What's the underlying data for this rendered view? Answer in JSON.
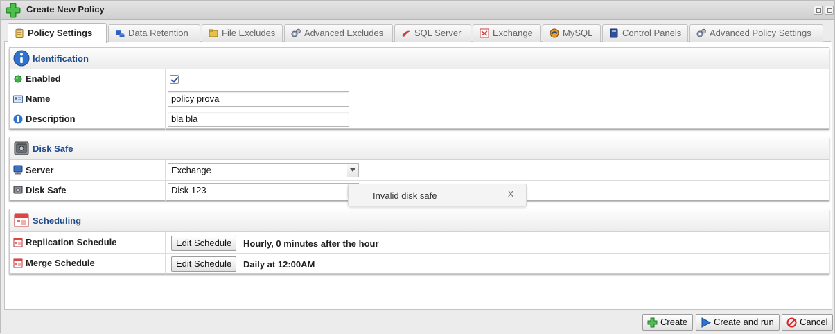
{
  "window": {
    "title": "Create New Policy",
    "window_buttons": [
      "restore-icon",
      "maximize-icon"
    ]
  },
  "tabs": [
    {
      "label": "Policy Settings",
      "icon": "clipboard-icon",
      "active": true
    },
    {
      "label": "Data Retention",
      "icon": "database-icon",
      "active": false
    },
    {
      "label": "File Excludes",
      "icon": "folder-icon",
      "active": false
    },
    {
      "label": "Advanced Excludes",
      "icon": "gears-icon",
      "active": false
    },
    {
      "label": "SQL Server",
      "icon": "sql-server-icon",
      "active": false
    },
    {
      "label": "Exchange",
      "icon": "exchange-icon",
      "active": false
    },
    {
      "label": "MySQL",
      "icon": "mysql-icon",
      "active": false
    },
    {
      "label": "Control Panels",
      "icon": "book-icon",
      "active": false
    },
    {
      "label": "Advanced Policy Settings",
      "icon": "gears-icon",
      "active": false
    }
  ],
  "identification": {
    "title": "Identification",
    "enabled_label": "Enabled",
    "enabled_checked": true,
    "name_label": "Name",
    "name_value": "policy prova",
    "description_label": "Description",
    "description_value": "bla bla"
  },
  "disk_safe": {
    "title": "Disk Safe",
    "server_label": "Server",
    "server_value": "Exchange",
    "disk_safe_label": "Disk Safe",
    "disk_safe_value": "Disk 123",
    "tooltip_text": "Invalid disk safe",
    "tooltip_close": "X"
  },
  "scheduling": {
    "title": "Scheduling",
    "replication_label": "Replication Schedule",
    "replication_button": "Edit Schedule",
    "replication_value": "Hourly, 0 minutes after the hour",
    "merge_label": "Merge Schedule",
    "merge_button": "Edit Schedule",
    "merge_value": "Daily at 12:00AM"
  },
  "footer": {
    "create_label": "Create",
    "create_run_label": "Create and run",
    "cancel_label": "Cancel"
  },
  "colors": {
    "section_title": "#1f4a8a",
    "status_ok": "#3cb043"
  }
}
